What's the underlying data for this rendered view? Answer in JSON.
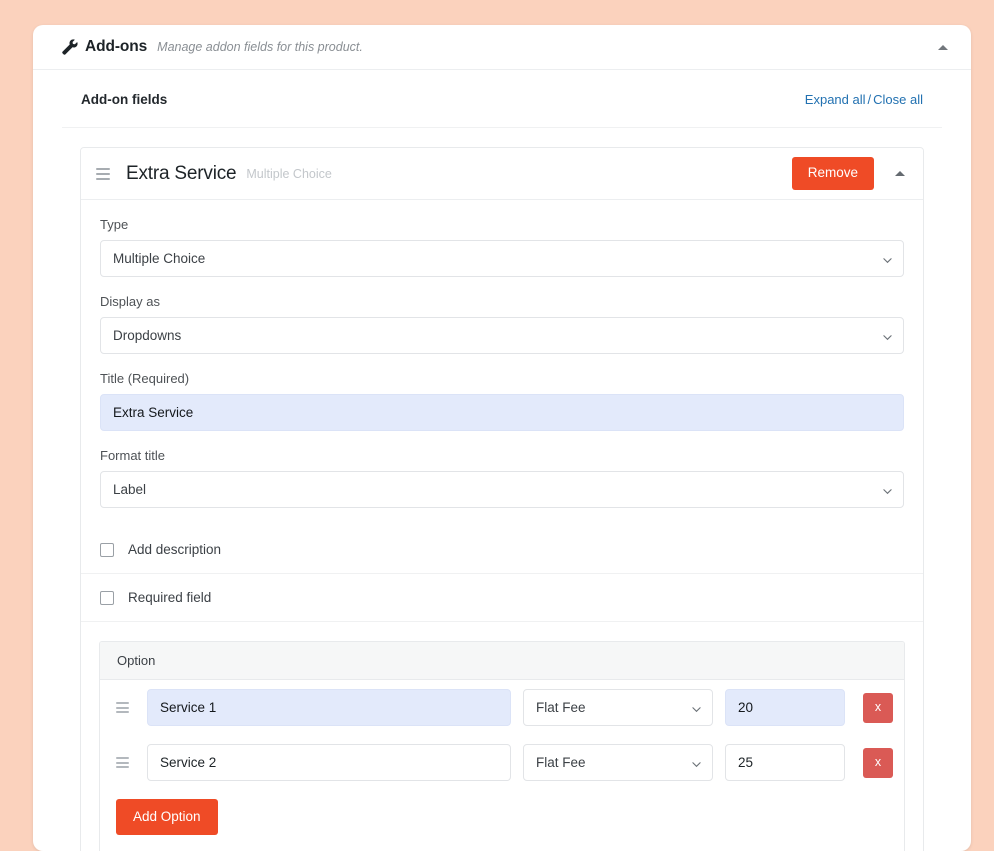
{
  "header": {
    "icon": "wrench-icon",
    "title": "Add-ons",
    "subtitle": "Manage addon fields for this product.",
    "collapse_icon": "caret-up-icon"
  },
  "fields_bar": {
    "title": "Add-on fields",
    "expand_all": "Expand all",
    "separator": "/",
    "close_all": "Close all"
  },
  "field": {
    "drag_icon": "drag-handle-icon",
    "title": "Extra Service",
    "type_label": "Multiple Choice",
    "remove_label": "Remove",
    "collapse_icon": "caret-up-icon",
    "type": {
      "label": "Type",
      "value": "Multiple Choice",
      "options": [
        "Multiple Choice"
      ]
    },
    "display_as": {
      "label": "Display as",
      "value": "Dropdowns",
      "options": [
        "Dropdowns"
      ]
    },
    "title_field": {
      "label": "Title (Required)",
      "value": "Extra Service",
      "placeholder": ""
    },
    "format_title": {
      "label": "Format title",
      "value": "Label",
      "options": [
        "Label"
      ]
    },
    "add_description": {
      "label": "Add description",
      "checked": false
    },
    "required_field": {
      "label": "Required field",
      "checked": false
    }
  },
  "options": {
    "column_header": "Option",
    "add_button": "Add Option",
    "delete_label": "x",
    "rows": [
      {
        "handle_icon": "drag-handle-icon",
        "name": "Service 1",
        "name_selected": true,
        "price_type": "Flat Fee",
        "price": "20",
        "price_selected": true
      },
      {
        "handle_icon": "drag-handle-icon",
        "name": "Service 2",
        "name_selected": false,
        "price_type": "Flat Fee",
        "price": "25",
        "price_selected": false
      }
    ]
  },
  "colors": {
    "page_background": "#fbd2bd",
    "card_background": "#ffffff",
    "primary_action": "#ef4b26",
    "delete_action": "#da5a55",
    "link": "#2271b1",
    "selected_input": "#e3eafb"
  }
}
